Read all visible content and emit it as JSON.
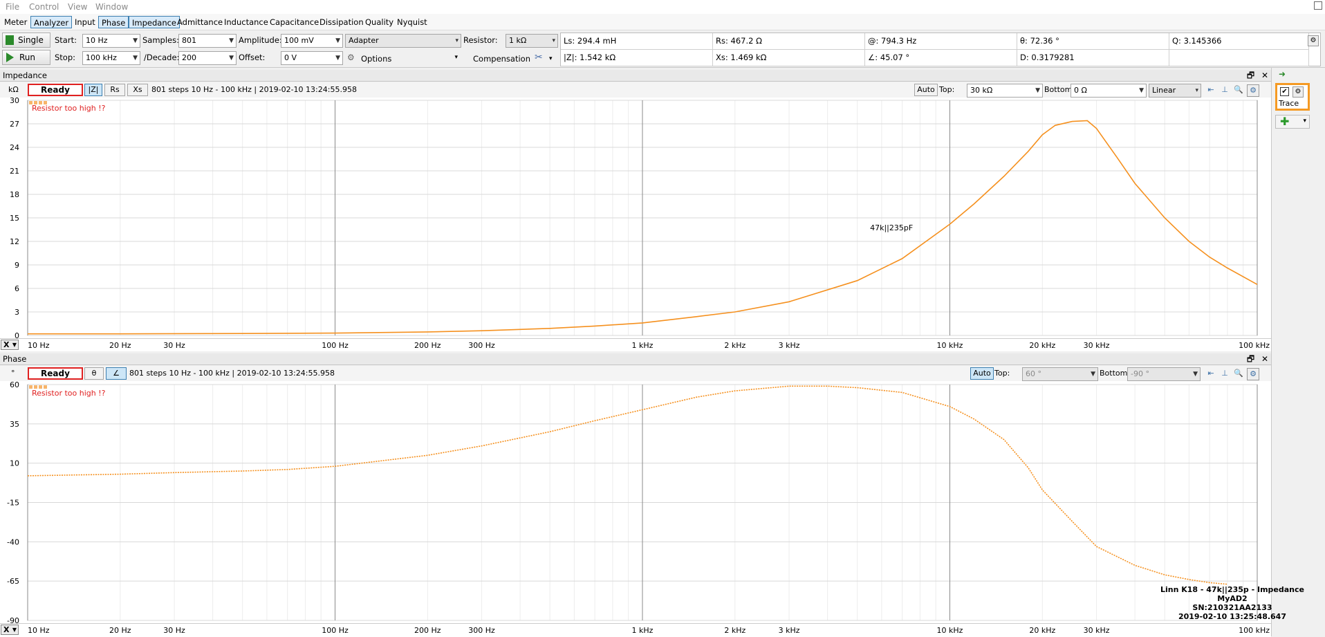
{
  "menu": [
    "File",
    "Control",
    "View",
    "Window"
  ],
  "tabs": [
    {
      "label": "Meter",
      "active": false
    },
    {
      "label": "Analyzer",
      "active": true
    },
    {
      "label": "Input",
      "active": false
    },
    {
      "label": "Phase",
      "active": true
    },
    {
      "label": "Impedance",
      "active": true
    },
    {
      "label": "Admittance",
      "active": false
    },
    {
      "label": "Inductance",
      "active": false
    },
    {
      "label": "Capacitance",
      "active": false
    },
    {
      "label": "Dissipation",
      "active": false
    },
    {
      "label": "Quality",
      "active": false
    },
    {
      "label": "Nyquist",
      "active": false
    }
  ],
  "toolbar": {
    "single_label": "Single",
    "run_label": "Run",
    "start_label": "Start:",
    "start_value": "10 Hz",
    "stop_label": "Stop:",
    "stop_value": "100 kHz",
    "samples_label": "Samples:",
    "samples_value": "801",
    "decade_label": "/Decade:",
    "decade_value": "200",
    "amplitude_label": "Amplitude:",
    "amplitude_value": "100 mV",
    "offset_label": "Offset:",
    "offset_value": "0 V",
    "adapter_value": "Adapter",
    "options_label": "Options",
    "resistor_label": "Resistor:",
    "resistor_value": "1 kΩ",
    "compensation_label": "Compensation"
  },
  "measurements": {
    "ls": "Ls: 294.4 mH",
    "rs": "Rs: 467.2 Ω",
    "freq": "@: 794.3 Hz",
    "theta": "θ: 72.36 °",
    "q": "Q: 3.145366",
    "z": "|Z|: 1.542 kΩ",
    "xs": "Xs: 1.469 kΩ",
    "angle": "∠: 45.07 °",
    "d": "D: 0.3179281"
  },
  "impedance_panel": {
    "title": "Impedance",
    "ready": "Ready",
    "btn_z": "|Z|",
    "btn_rs": "Rs",
    "btn_xs": "Xs",
    "status": "801 steps 10 Hz - 100 kHz | 2019-02-10 13:24:55.958",
    "auto_label": "Auto",
    "top_label": "Top:",
    "top_value": "30 kΩ",
    "bottom_label": "Bottom:",
    "bottom_value": "0 Ω",
    "scale_value": "Linear",
    "warning": "Resistor too high !?",
    "unit": "kΩ",
    "axis_select": "X"
  },
  "phase_panel": {
    "title": "Phase",
    "ready": "Ready",
    "btn_theta": "θ",
    "btn_angle": "∠",
    "status": "801 steps 10 Hz - 100 kHz | 2019-02-10 13:24:55.958",
    "auto_label": "Auto",
    "top_label": "Top:",
    "top_value": "60 °",
    "bottom_label": "Bottom:",
    "bottom_value": "-90 °",
    "warning": "Resistor too high !?",
    "unit": "°",
    "axis_select": "X"
  },
  "right_panel": {
    "trace_label": "Trace"
  },
  "annotation": {
    "line1": "Linn K18 - 47k||235p - Impedance",
    "line2": "MyAD2",
    "line3": "SN:210321AA2133",
    "line4": "2019-02-10 13:25:48.647"
  },
  "colors": {
    "trace": "#f5901e",
    "ready_border": "#e02020",
    "highlight": "#f59a23",
    "active_tab": "#d8eaf9"
  },
  "chart_data": [
    {
      "type": "line",
      "title": "Impedance",
      "ylabel": "kΩ",
      "xscale": "log",
      "xlim": [
        10,
        100000
      ],
      "ylim": [
        0,
        30
      ],
      "yticks": [
        0,
        3,
        6,
        9,
        12,
        15,
        18,
        21,
        24,
        27,
        30
      ],
      "xticks": [
        {
          "v": 10,
          "l": "10 Hz"
        },
        {
          "v": 20,
          "l": "20 Hz"
        },
        {
          "v": 30,
          "l": "30 Hz"
        },
        {
          "v": 100,
          "l": "100 Hz"
        },
        {
          "v": 200,
          "l": "200 Hz"
        },
        {
          "v": 300,
          "l": "300 Hz"
        },
        {
          "v": 1000,
          "l": "1 kHz"
        },
        {
          "v": 2000,
          "l": "2 kHz"
        },
        {
          "v": 3000,
          "l": "3 kHz"
        },
        {
          "v": 10000,
          "l": "10 kHz"
        },
        {
          "v": 20000,
          "l": "20 kHz"
        },
        {
          "v": 30000,
          "l": "30 kHz"
        },
        {
          "v": 100000,
          "l": "100 kHz"
        }
      ],
      "annotation": {
        "text": "47k||235pF",
        "x": 5500,
        "y": 13.4
      },
      "series": [
        {
          "x": [
            10,
            20,
            50,
            100,
            200,
            300,
            500,
            700,
            1000,
            1500,
            2000,
            3000,
            5000,
            7000,
            10000,
            12000,
            15000,
            18000,
            20000,
            22000,
            25000,
            28000,
            30000,
            35000,
            40000,
            50000,
            60000,
            70000,
            80000,
            100000
          ],
          "y": [
            0.2,
            0.2,
            0.25,
            0.3,
            0.45,
            0.6,
            0.9,
            1.2,
            1.6,
            2.4,
            3.0,
            4.3,
            7.0,
            9.8,
            14.2,
            16.8,
            20.3,
            23.5,
            25.6,
            26.8,
            27.3,
            27.4,
            26.4,
            22.7,
            19.4,
            15.0,
            12.0,
            10.0,
            8.6,
            6.5
          ]
        }
      ]
    },
    {
      "type": "line",
      "title": "Phase",
      "ylabel": "°",
      "xscale": "log",
      "xlim": [
        10,
        100000
      ],
      "ylim": [
        -90,
        60
      ],
      "yticks": [
        -90,
        -65,
        -40,
        -15,
        10,
        35,
        60
      ],
      "xticks": [
        {
          "v": 10,
          "l": "10 Hz"
        },
        {
          "v": 20,
          "l": "20 Hz"
        },
        {
          "v": 30,
          "l": "30 Hz"
        },
        {
          "v": 100,
          "l": "100 Hz"
        },
        {
          "v": 200,
          "l": "200 Hz"
        },
        {
          "v": 300,
          "l": "300 Hz"
        },
        {
          "v": 1000,
          "l": "1 kHz"
        },
        {
          "v": 2000,
          "l": "2 kHz"
        },
        {
          "v": 3000,
          "l": "3 kHz"
        },
        {
          "v": 10000,
          "l": "10 kHz"
        },
        {
          "v": 20000,
          "l": "20 kHz"
        },
        {
          "v": 30000,
          "l": "30 kHz"
        },
        {
          "v": 100000,
          "l": "100 kHz"
        }
      ],
      "series": [
        {
          "x": [
            10,
            20,
            30,
            50,
            70,
            100,
            200,
            300,
            500,
            700,
            1000,
            1500,
            2000,
            3000,
            4000,
            5000,
            7000,
            10000,
            12000,
            15000,
            18000,
            20000,
            25000,
            30000,
            40000,
            50000,
            60000,
            70000,
            80000
          ],
          "y": [
            2,
            3,
            4,
            5,
            6,
            8,
            15,
            21,
            30,
            37,
            44,
            52,
            56,
            59,
            59,
            58,
            55,
            46,
            38,
            25,
            7,
            -7,
            -27,
            -43,
            -55,
            -61,
            -64,
            -66,
            -67
          ]
        }
      ]
    }
  ]
}
